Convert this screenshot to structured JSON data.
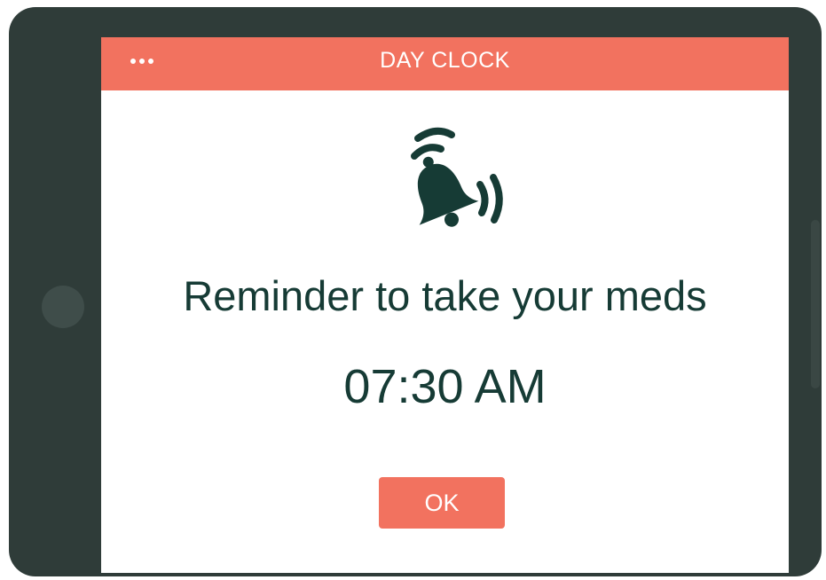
{
  "app": {
    "title": "DAY CLOCK",
    "menu_icon": "more-dots-icon"
  },
  "alarm": {
    "icon": "ringing-bell-icon",
    "message": "Reminder to take your meds",
    "time": "07:30 AM"
  },
  "actions": {
    "ok_label": "OK"
  },
  "colors": {
    "accent": "#f2725f",
    "device_frame": "#2f3c39",
    "text": "#163b35",
    "background": "#ffffff"
  }
}
